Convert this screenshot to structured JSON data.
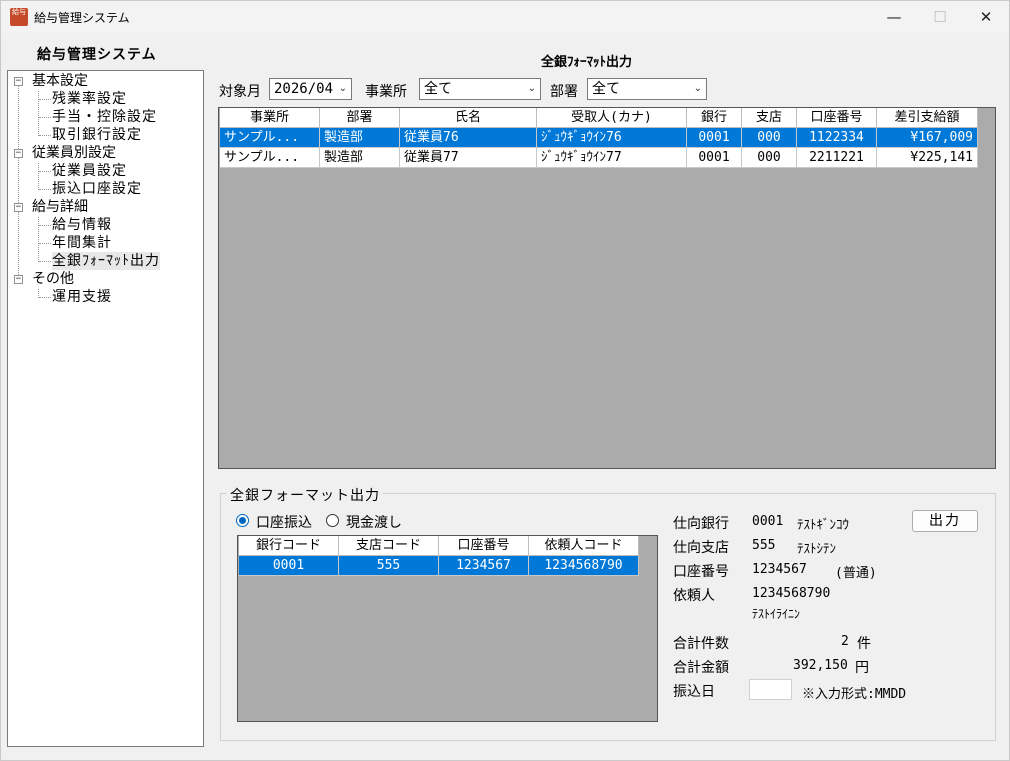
{
  "window": {
    "title": "給与管理システム",
    "app_icon_text": "給与"
  },
  "sidebar": {
    "heading": "給与管理システム",
    "tree": [
      {
        "label": "基本設定",
        "children": [
          "残業率設定",
          "手当・控除設定",
          "取引銀行設定"
        ]
      },
      {
        "label": "従業員別設定",
        "children": [
          "従業員設定",
          "振込口座設定"
        ]
      },
      {
        "label": "給与詳細",
        "children": [
          "給与情報",
          "年間集計",
          "全銀ﾌｫｰﾏｯﾄ出力"
        ]
      },
      {
        "label": "その他",
        "children": [
          "運用支援"
        ]
      }
    ],
    "selected": "全銀ﾌｫｰﾏｯﾄ出力"
  },
  "main": {
    "page_title": "全銀ﾌｫｰﾏｯﾄ出力",
    "filters": {
      "month_label": "対象月",
      "month_value": "2026/04",
      "office_label": "事業所",
      "office_value": "全て",
      "dept_label": "部署",
      "dept_value": "全て"
    },
    "grid": {
      "headers": [
        "事業所",
        "部署",
        "氏名",
        "受取人(カナ)",
        "銀行",
        "支店",
        "口座番号",
        "差引支給額"
      ],
      "rows": [
        [
          "サンプル...",
          "製造部",
          "従業員76",
          "ｼﾞｭｳｷﾞｮｳｲﾝ76",
          "0001",
          "000",
          "1122334",
          "¥167,009"
        ],
        [
          "サンプル...",
          "製造部",
          "従業員77",
          "ｼﾞｭｳｷﾞｮｳｲﾝ77",
          "0001",
          "000",
          "2211221",
          "¥225,141"
        ]
      ],
      "selected_row": 0
    }
  },
  "export": {
    "group_title": "全銀フォーマット出力",
    "radios": [
      {
        "label": "口座振込",
        "checked": true
      },
      {
        "label": "現金渡し",
        "checked": false
      }
    ],
    "grid": {
      "headers": [
        "銀行コード",
        "支店コード",
        "口座番号",
        "依頼人コード"
      ],
      "row": [
        "0001",
        "555",
        "1234567",
        "1234568790"
      ]
    },
    "info": {
      "bank_label": "仕向銀行",
      "bank_code": "0001",
      "bank_name": "ﾃｽﾄｷﾞﾝｺｳ",
      "branch_label": "仕向支店",
      "branch_code": "555",
      "branch_name": "ﾃｽﾄｼﾃﾝ",
      "account_label": "口座番号",
      "account_no": "1234567",
      "account_type": "(普通)",
      "requester_label": "依頼人",
      "requester_code": "1234568790",
      "requester_name": "ﾃｽﾄｲﾗｲﾆﾝ",
      "count_label": "合計件数",
      "count_value": "2",
      "count_unit": "件",
      "amount_label": "合計金額",
      "amount_value": "392,150",
      "amount_unit": "円",
      "date_label": "振込日",
      "date_value": "",
      "date_note": "※入力形式:MMDD"
    },
    "output_button": "出力"
  }
}
